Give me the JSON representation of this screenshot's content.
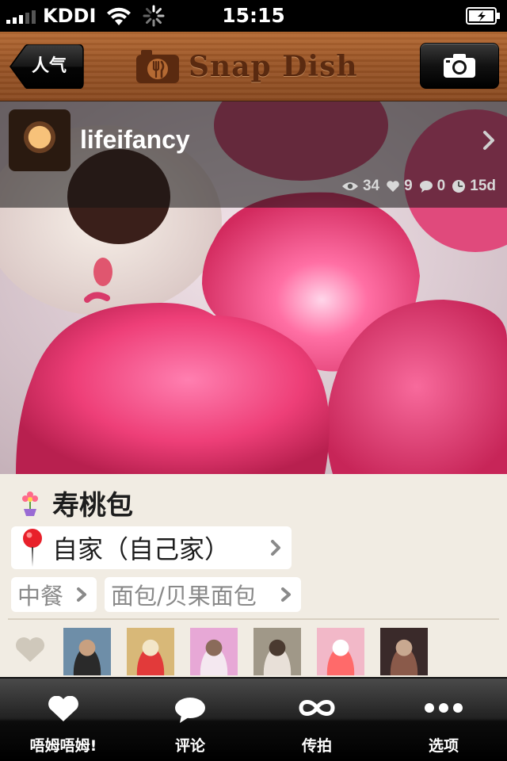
{
  "status_bar": {
    "carrier": "KDDI",
    "time": "15:15"
  },
  "nav": {
    "back_label": "人气",
    "brand": "Snap Dish"
  },
  "post": {
    "username": "lifeifancy",
    "stats": {
      "views": "34",
      "likes": "9",
      "comments": "0",
      "age": "15d"
    }
  },
  "dish": {
    "name": "寿桃包",
    "location": "自家（自己家）",
    "tags": [
      "中餐",
      "面包/贝果面包"
    ]
  },
  "likers": [
    {
      "label": "liker-1",
      "colors": [
        "#6e8ea8",
        "#2a2a2a",
        "#c8a080"
      ]
    },
    {
      "label": "liker-2",
      "colors": [
        "#d8b878",
        "#e23a3a",
        "#f3e6c8"
      ]
    },
    {
      "label": "liker-3",
      "colors": [
        "#e7a8d6",
        "#f4e8f0",
        "#8a6b5a"
      ]
    },
    {
      "label": "liker-4",
      "colors": [
        "#a09888",
        "#e8e0d8",
        "#4a3a30"
      ]
    },
    {
      "label": "liker-5",
      "colors": [
        "#f2b8c8",
        "#ff6a6a",
        "#ffffff"
      ]
    },
    {
      "label": "liker-6",
      "colors": [
        "#3a2a2a",
        "#8a5a4a",
        "#c8a890"
      ]
    }
  ],
  "tabs": [
    {
      "label": "唔姆唔姆!",
      "icon": "heart-icon"
    },
    {
      "label": "评论",
      "icon": "speech-bubble-icon"
    },
    {
      "label": "传拍",
      "icon": "infinity-icon"
    },
    {
      "label": "选项",
      "icon": "more-dots-icon"
    }
  ],
  "colors": {
    "nav_wood": "#9a5527",
    "accent_pink": "#ee3f78",
    "details_bg": "#f1ece3"
  }
}
